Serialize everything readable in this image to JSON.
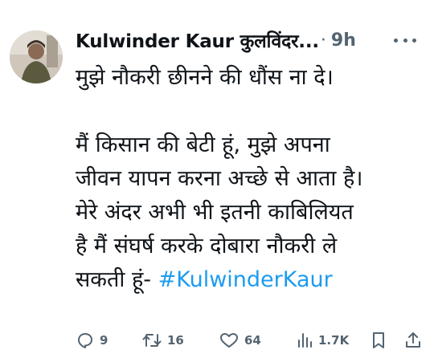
{
  "tweet": {
    "author_name": "Kulwinder Kaur कुलविंदर...",
    "separator": "·",
    "time": "9h",
    "text_line1": "मुझे नौकरी छीनने की धौंस ना दे।",
    "text_para2": "मैं किसान की बेटी हूं, मुझे अपना\nजीवन यापन करना अच्छे से आता है।\nमेरे अंदर अभी भी इतनी काबिलियत\nहै मैं संघर्ष करके दोबारा नौकरी ले\nसकती हूं- ",
    "hashtag": "#KulwinderKaur"
  },
  "actions": {
    "replies": "9",
    "retweets": "16",
    "likes": "64",
    "views": "1.7K"
  },
  "icons": [
    "more-options-icon",
    "reply-icon",
    "retweet-icon",
    "like-icon",
    "views-icon",
    "bookmark-icon",
    "share-icon"
  ],
  "colors": {
    "text": "#0f1419",
    "muted": "#536471",
    "hashtag": "#1d9bf0"
  }
}
